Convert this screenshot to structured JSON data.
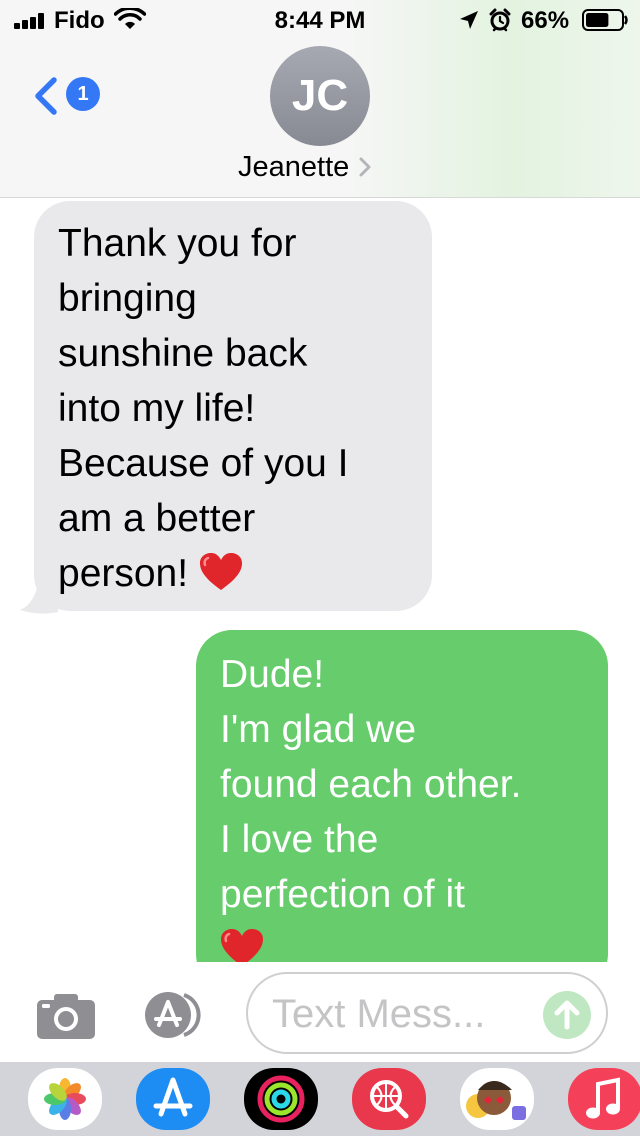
{
  "status_bar": {
    "carrier": "Fido",
    "time": "8:44 PM",
    "battery": "66%",
    "battery_level": 0.66,
    "icons": [
      "signal-icon",
      "wifi-icon",
      "location-arrow-icon",
      "alarm-icon",
      "battery-icon"
    ]
  },
  "header": {
    "back_badge": "1",
    "avatar_initials": "JC",
    "contact_name": "Jeanette",
    "icons": [
      "back-chevron-icon",
      "chevron-right-icon"
    ]
  },
  "messages": [
    {
      "direction": "incoming",
      "text": "Thank you for\nbringing\nsunshine back\ninto my life!\nBecause of you I\nam a better\nperson! ",
      "emoji": "red-heart-icon"
    },
    {
      "direction": "outgoing",
      "text": "Dude!\nI'm glad we\nfound each other.\nI love the\nperfection of it\n",
      "emoji": "red-heart-icon"
    }
  ],
  "input_bar": {
    "placeholder": "Text Mess...",
    "icons": [
      "camera-icon",
      "app-store-icon",
      "send-arrow-icon"
    ]
  },
  "app_drawer": {
    "apps": [
      "photos-icon",
      "app-store-icon",
      "activity-icon",
      "web-search-icon",
      "memoji-icon",
      "music-icon"
    ]
  },
  "colors": {
    "incoming_bubble": "#e9e9eb",
    "outgoing_bubble": "#66cc6c",
    "accent_blue": "#3478f6",
    "avatar_gray": "#979aa2"
  }
}
